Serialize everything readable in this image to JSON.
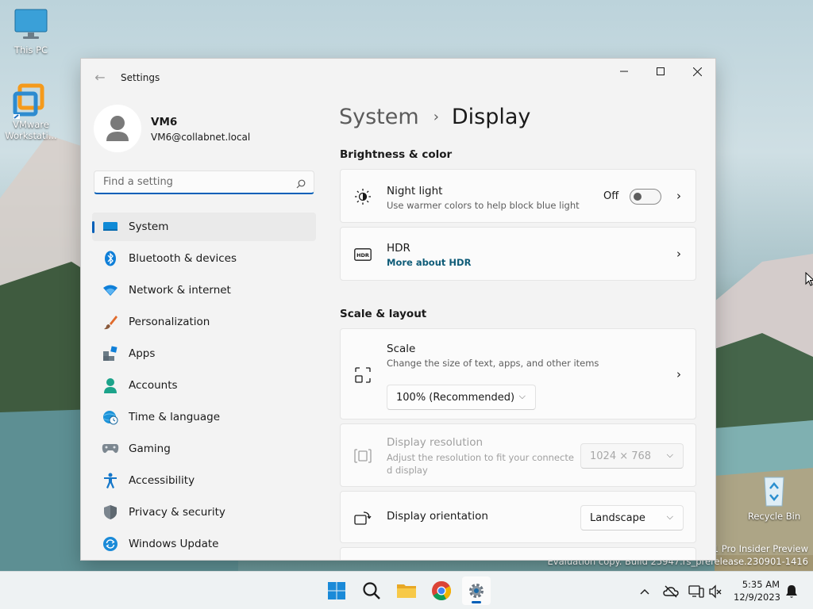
{
  "desktop": {
    "icons": [
      {
        "label": "This PC"
      },
      {
        "label": "VMware Workstati..."
      },
      {
        "label": "Recycle Bin"
      }
    ],
    "watermark": {
      "line1": "11 Pro Insider Preview",
      "line2": "Evaluation copy. Build 25947.rs_prerelease.230901-1416"
    }
  },
  "window": {
    "title": "Settings",
    "controls": [
      "minimize",
      "maximize",
      "close"
    ]
  },
  "profile": {
    "name": "VM6",
    "email": "VM6@collabnet.local"
  },
  "search": {
    "placeholder": "Find a setting"
  },
  "sidebar": {
    "items": [
      {
        "label": "System",
        "icon": "system-monitor-icon",
        "active": true
      },
      {
        "label": "Bluetooth & devices",
        "icon": "bluetooth-icon"
      },
      {
        "label": "Network & internet",
        "icon": "wifi-icon"
      },
      {
        "label": "Personalization",
        "icon": "brush-icon"
      },
      {
        "label": "Apps",
        "icon": "apps-icon"
      },
      {
        "label": "Accounts",
        "icon": "person-icon"
      },
      {
        "label": "Time & language",
        "icon": "globe-clock-icon"
      },
      {
        "label": "Gaming",
        "icon": "gamepad-icon"
      },
      {
        "label": "Accessibility",
        "icon": "accessibility-icon"
      },
      {
        "label": "Privacy & security",
        "icon": "shield-icon"
      },
      {
        "label": "Windows Update",
        "icon": "update-icon"
      }
    ]
  },
  "breadcrumb": {
    "parent": "System",
    "separator": "›",
    "current": "Display"
  },
  "sections": {
    "brightness": "Brightness & color",
    "scale_layout": "Scale & layout"
  },
  "night_light": {
    "title": "Night light",
    "subtitle": "Use warmer colors to help block blue light",
    "state_label": "Off",
    "on": false
  },
  "hdr": {
    "title": "HDR",
    "link": "More about HDR"
  },
  "scale": {
    "title": "Scale",
    "subtitle": "Change the size of text, apps, and other items",
    "value": "100% (Recommended)"
  },
  "resolution": {
    "title": "Display resolution",
    "subtitle_line1": "Adjust the resolution to fit your connecte",
    "subtitle_line2": "d display",
    "value": "1024 × 768",
    "disabled": true
  },
  "orientation": {
    "title": "Display orientation",
    "value": "Landscape"
  },
  "taskbar": {
    "apps": [
      "start-icon",
      "search-icon",
      "file-explorer-icon",
      "chrome-icon",
      "settings-icon"
    ],
    "clock_time": "5:35 AM",
    "clock_date": "12/9/2023"
  },
  "colors": {
    "accent": "#005fb8",
    "window_bg": "#f3f3f3",
    "card_bg": "#fbfbfb"
  }
}
